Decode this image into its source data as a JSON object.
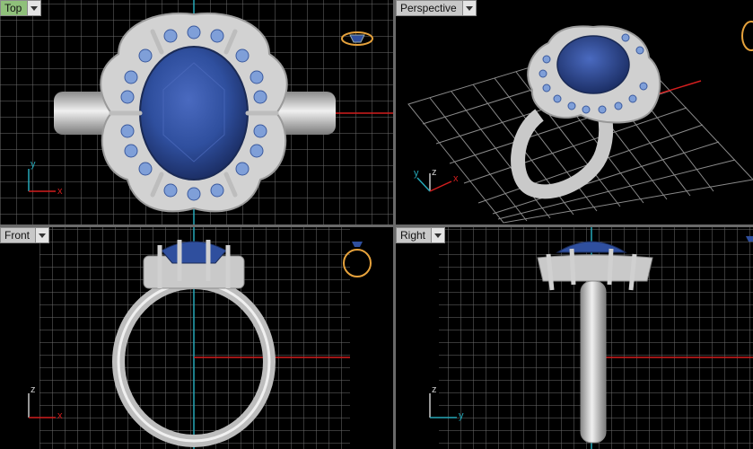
{
  "viewports": {
    "top": {
      "label": "Top",
      "active": true
    },
    "perspective": {
      "label": "Perspective",
      "active": false
    },
    "front": {
      "label": "Front",
      "active": false
    },
    "right": {
      "label": "Right",
      "active": false
    }
  },
  "axes": {
    "top": [
      "y",
      "x"
    ],
    "perspective": [
      "z",
      "y",
      "x"
    ],
    "front": [
      "z",
      "x"
    ],
    "right": [
      "z",
      "y"
    ]
  },
  "colors": {
    "background": "#000000",
    "grid": "#6e6e6e",
    "grid_major": "#9a9a9a",
    "metal": "#c9c9c9",
    "gem": "#2f4f9e",
    "accent_gem": "#7f9fd8",
    "x_axis": "#d21e1e",
    "y_axis": "#25a8b8",
    "z_axis": "#c9c9c9",
    "active_tab": "#8fc07a",
    "gold_icon": "#e6a23c"
  },
  "icons": {
    "dropdown": "chevron-down-icon",
    "gizmo": "ring-thumbnail-icon"
  }
}
